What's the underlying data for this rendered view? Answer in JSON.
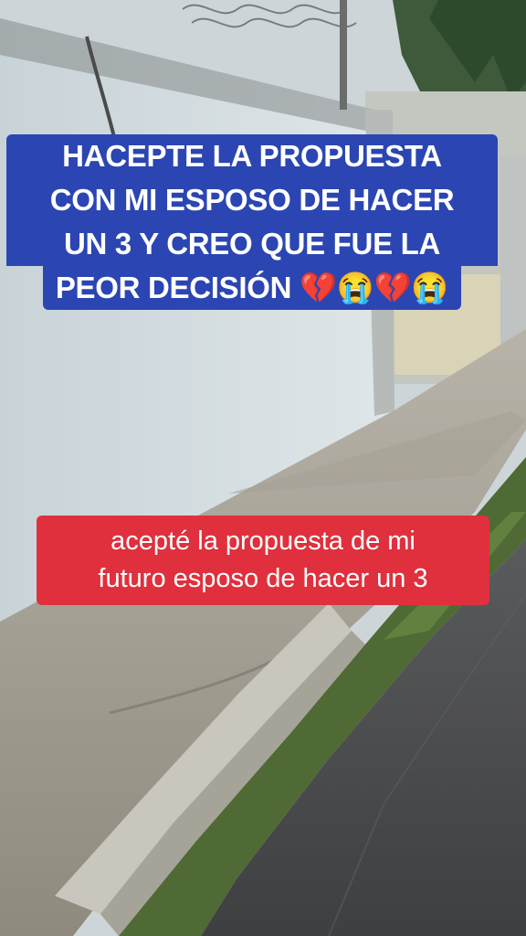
{
  "scene": {
    "description_icon": "street-photo",
    "colors": {
      "sky": "#c9d2d6",
      "wall": "#d4dde0",
      "sidewalk": "#9b968a",
      "grass": "#4f6a34",
      "asphalt": "#4a4a4c"
    }
  },
  "captions": {
    "top": {
      "lines": [
        "HACEPTE LA PROPUESTA",
        "CON MI ESPOSO DE HACER",
        "UN  3 Y CREO QUE FUE LA",
        "PEOR DECISIÓN 💔😭💔😭"
      ],
      "background": "#2b46b2"
    },
    "bottom": {
      "lines": [
        "acepté la propuesta de mi",
        "futuro esposo de hacer un 3"
      ],
      "background": "#e0303d"
    }
  }
}
